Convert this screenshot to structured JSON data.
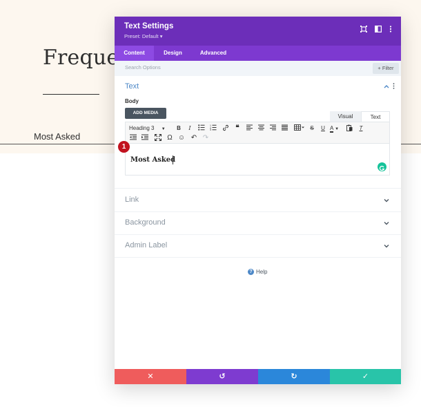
{
  "background": {
    "heading": "Frequen",
    "tab_label": "Most Asked"
  },
  "modal": {
    "title": "Text Settings",
    "preset": "Preset: Default ▾",
    "header_icons": [
      "expand-icon",
      "sidebar-icon",
      "more-icon"
    ],
    "tabs": [
      {
        "label": "Content",
        "active": true
      },
      {
        "label": "Design",
        "active": false
      },
      {
        "label": "Advanced",
        "active": false
      }
    ],
    "search": {
      "placeholder": "Search Options"
    },
    "filter_label": "+ Filter",
    "sections": {
      "text": {
        "title": "Text",
        "expanded": true
      },
      "link": {
        "title": "Link"
      },
      "background": {
        "title": "Background"
      },
      "admin_label": {
        "title": "Admin Label"
      }
    },
    "body_label": "Body",
    "add_media_label": "ADD MEDIA",
    "editor_tabs": {
      "visual": "Visual",
      "text": "Text"
    },
    "toolbar": {
      "format_select": "Heading 3",
      "buttons": [
        "bold",
        "italic",
        "bullet-list",
        "numbered-list",
        "link",
        "blockquote",
        "align-left",
        "align-center",
        "align-right",
        "justify",
        "table",
        "strikethrough",
        "underline",
        "text-color",
        "paste",
        "clear-format",
        "outdent",
        "indent",
        "fullscreen",
        "special-char",
        "emoji",
        "undo",
        "redo"
      ]
    },
    "editor_content": "Most Asked",
    "help_label": "Help",
    "footer_buttons": [
      {
        "name": "cancel",
        "icon": "✕",
        "color": "#ef5c5c"
      },
      {
        "name": "undo",
        "icon": "↺",
        "color": "#7e3bd0"
      },
      {
        "name": "redo",
        "icon": "↻",
        "color": "#2b87da"
      },
      {
        "name": "save",
        "icon": "✓",
        "color": "#29c4a9"
      }
    ]
  },
  "callout_badge": "1",
  "colors": {
    "header_purple": "#6c2eb9",
    "tabs_purple": "#7d39d0",
    "accent_blue": "#4d88c7",
    "badge_red": "#c1121f",
    "page_cream": "#fdf7ef"
  }
}
